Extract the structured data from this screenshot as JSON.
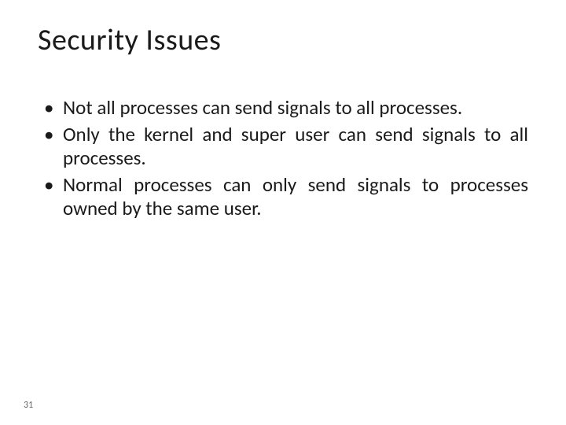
{
  "slide": {
    "title": "Security Issues",
    "bullets": [
      "Not all processes can send signals to all processes.",
      "Only the kernel and super user can send signals to all processes.",
      "Normal processes can only send signals to processes owned by the same user."
    ],
    "page_number": "31"
  }
}
